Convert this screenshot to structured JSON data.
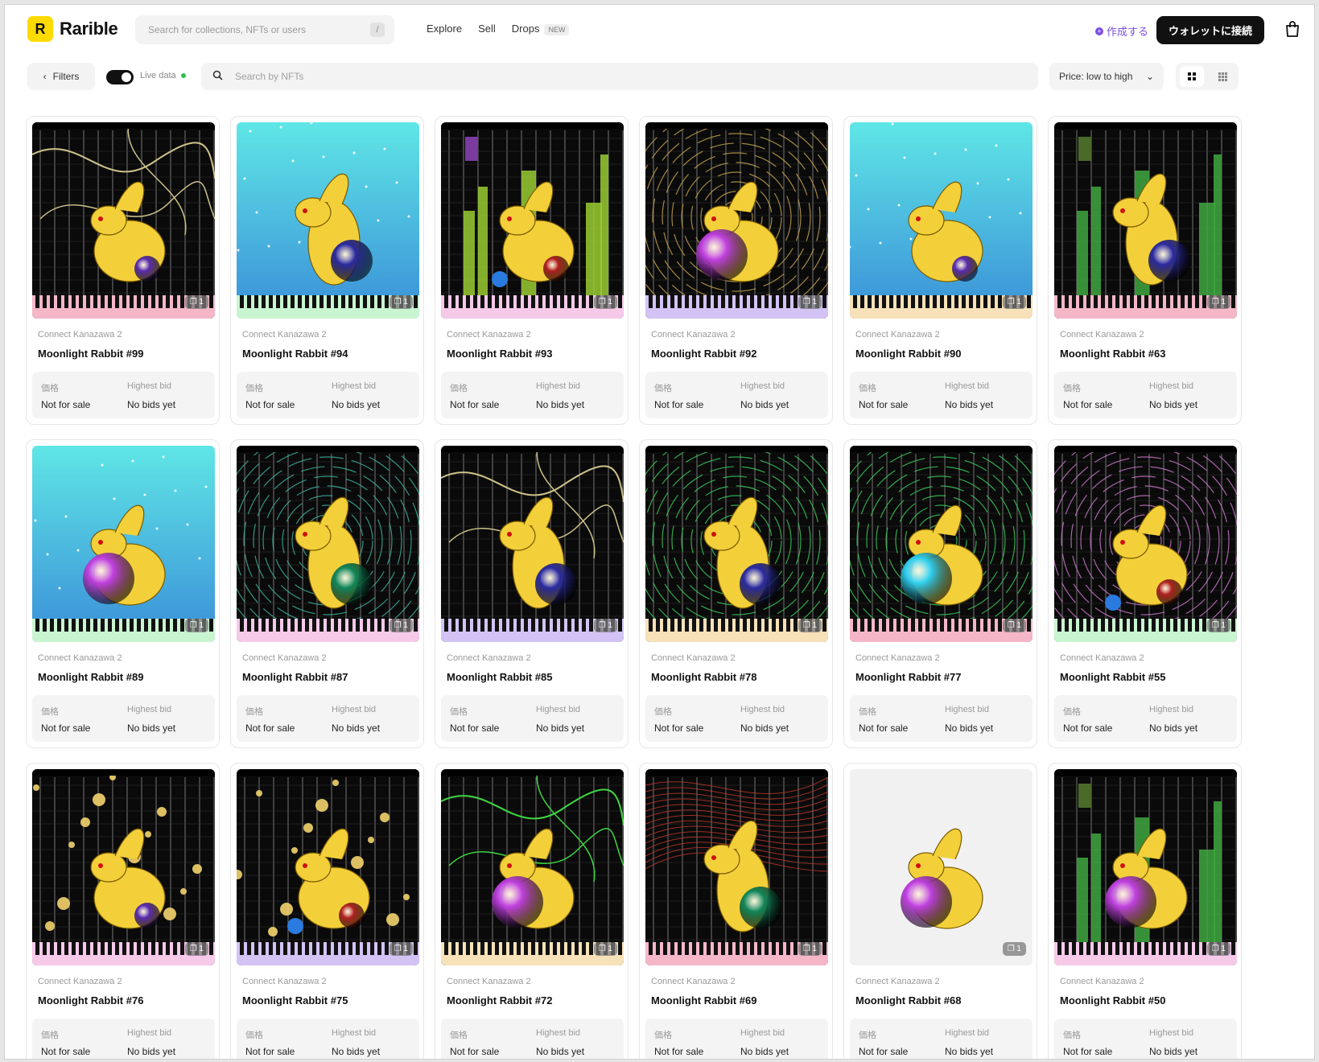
{
  "brand": {
    "name": "Rarible",
    "logo_letter": "R",
    "accent": "#FEDA03"
  },
  "global_search": {
    "placeholder": "Search for collections, NFTs or users",
    "shortcut": "/"
  },
  "nav": {
    "explore": "Explore",
    "sell": "Sell",
    "drops": "Drops",
    "drops_badge": "NEW"
  },
  "header": {
    "create": "作成する",
    "connect_wallet": "ウォレットに接続"
  },
  "toolbar": {
    "filters": "Filters",
    "live_data": "Live data",
    "search_placeholder": "Search by NFTs",
    "sort": "Price: low to high"
  },
  "labels": {
    "price": "価格",
    "highest_bid": "Highest bid"
  },
  "items": [
    {
      "collection": "Connect Kanazawa 2",
      "name": "Moonlight Rabbit #99",
      "price": "Not for sale",
      "bid": "No bids yet",
      "count": "1",
      "style": "gold",
      "orb": "#5a2bb0",
      "pose": "crouch"
    },
    {
      "collection": "Connect Kanazawa 2",
      "name": "Moonlight Rabbit #94",
      "price": "Not for sale",
      "bid": "No bids yet",
      "count": "1",
      "style": "sky",
      "orb": "#2a2aa0",
      "pose": "sit"
    },
    {
      "collection": "Connect Kanazawa 2",
      "name": "Moonlight Rabbit #93",
      "price": "Not for sale",
      "bid": "No bids yet",
      "count": "1",
      "style": "bars",
      "orb": "#b02020",
      "pose": "crouch"
    },
    {
      "collection": "Connect Kanazawa 2",
      "name": "Moonlight Rabbit #92",
      "price": "Not for sale",
      "bid": "No bids yet",
      "count": "1",
      "style": "rings",
      "orb": "#c040e0",
      "pose": "hug"
    },
    {
      "collection": "Connect Kanazawa 2",
      "name": "Moonlight Rabbit #90",
      "price": "Not for sale",
      "bid": "No bids yet",
      "count": "1",
      "style": "sky",
      "orb": "#5a2bb0",
      "pose": "crouch"
    },
    {
      "collection": "Connect Kanazawa 2",
      "name": "Moonlight Rabbit #63",
      "price": "Not for sale",
      "bid": "No bids yet",
      "count": "1",
      "style": "greenbars",
      "orb": "#2a2aa0",
      "pose": "sit"
    },
    {
      "collection": "Connect Kanazawa 2",
      "name": "Moonlight Rabbit #89",
      "price": "Not for sale",
      "bid": "No bids yet",
      "count": "1",
      "style": "sky",
      "orb": "#c040e0",
      "pose": "hug"
    },
    {
      "collection": "Connect Kanazawa 2",
      "name": "Moonlight Rabbit #87",
      "price": "Not for sale",
      "bid": "No bids yet",
      "count": "1",
      "style": "tealrings",
      "orb": "#11865a",
      "pose": "sit"
    },
    {
      "collection": "Connect Kanazawa 2",
      "name": "Moonlight Rabbit #85",
      "price": "Not for sale",
      "bid": "No bids yet",
      "count": "1",
      "style": "gold",
      "orb": "#2a2aa0",
      "pose": "sit"
    },
    {
      "collection": "Connect Kanazawa 2",
      "name": "Moonlight Rabbit #78",
      "price": "Not for sale",
      "bid": "No bids yet",
      "count": "1",
      "style": "greenrings",
      "orb": "#2a2aa0",
      "pose": "sit"
    },
    {
      "collection": "Connect Kanazawa 2",
      "name": "Moonlight Rabbit #77",
      "price": "Not for sale",
      "bid": "No bids yet",
      "count": "1",
      "style": "greenrings",
      "orb": "#30d0f0",
      "pose": "hug"
    },
    {
      "collection": "Connect Kanazawa 2",
      "name": "Moonlight Rabbit #55",
      "price": "Not for sale",
      "bid": "No bids yet",
      "count": "1",
      "style": "pinkrings",
      "orb": "#b02020",
      "pose": "crouch"
    },
    {
      "collection": "Connect Kanazawa 2",
      "name": "Moonlight Rabbit #76",
      "price": "Not for sale",
      "bid": "No bids yet",
      "count": "1",
      "style": "dots",
      "orb": "#5a2bb0",
      "pose": "crouch"
    },
    {
      "collection": "Connect Kanazawa 2",
      "name": "Moonlight Rabbit #75",
      "price": "Not for sale",
      "bid": "No bids yet",
      "count": "1",
      "style": "dots",
      "orb": "#b02020",
      "pose": "crouch"
    },
    {
      "collection": "Connect Kanazawa 2",
      "name": "Moonlight Rabbit #72",
      "price": "Not for sale",
      "bid": "No bids yet",
      "count": "1",
      "style": "vines",
      "orb": "#c040e0",
      "pose": "hug"
    },
    {
      "collection": "Connect Kanazawa 2",
      "name": "Moonlight Rabbit #69",
      "price": "Not for sale",
      "bid": "No bids yet",
      "count": "1",
      "style": "redstreaks",
      "orb": "#11865a",
      "pose": "sit"
    },
    {
      "collection": "Connect Kanazawa 2",
      "name": "Moonlight Rabbit #68",
      "price": "Not for sale",
      "bid": "No bids yet",
      "count": "1",
      "style": "plain",
      "orb": "#c040e0",
      "pose": "hug"
    },
    {
      "collection": "Connect Kanazawa 2",
      "name": "Moonlight Rabbit #50",
      "price": "Not for sale",
      "bid": "No bids yet",
      "count": "1",
      "style": "greenbars",
      "orb": "#c040e0",
      "pose": "hug"
    }
  ]
}
